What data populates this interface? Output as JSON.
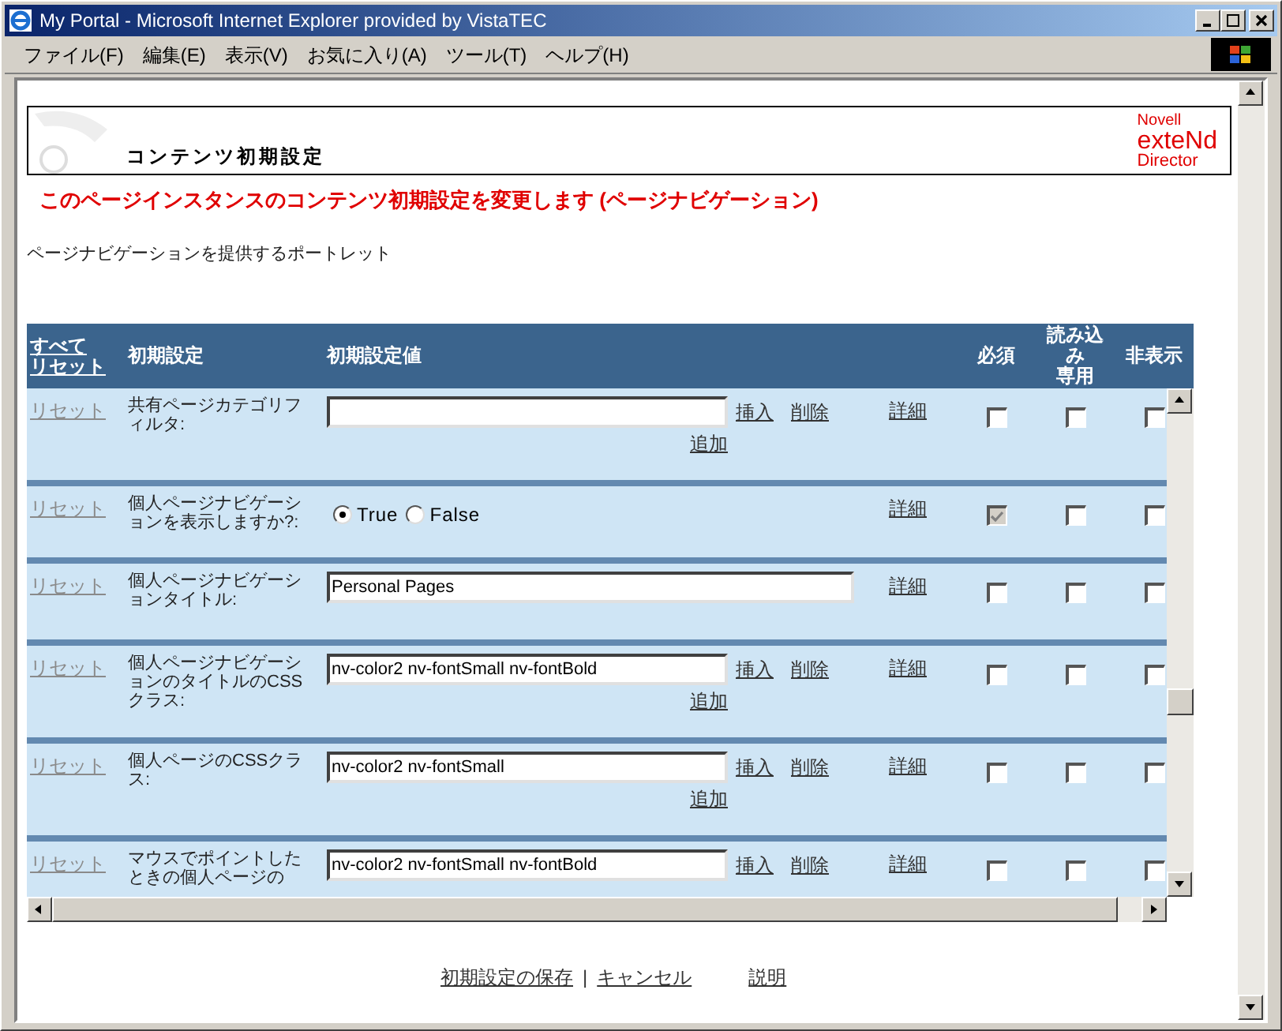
{
  "window": {
    "title": "My Portal - Microsoft Internet Explorer provided by VistaTEC"
  },
  "menu": [
    "ファイル(F)",
    "編集(E)",
    "表示(V)",
    "お気に入り(A)",
    "ツール(T)",
    "ヘルプ(H)"
  ],
  "portlet": {
    "title": "コンテンツ初期設定",
    "logo": {
      "brand": "Novell",
      "product": "exteNd",
      "edition": "Director"
    }
  },
  "heading": "このページインスタンスのコンテンツ初期設定を変更します (ページナビゲーション)",
  "description": "ページナビゲーションを提供するポートレット",
  "table": {
    "header": {
      "reset_all": [
        "すべて",
        "リセット"
      ],
      "setting": "初期設定",
      "value": "初期設定値",
      "required": "必須",
      "read_only": [
        "読み込み",
        "専用"
      ],
      "hidden": "非表示"
    },
    "rows": [
      {
        "kind": "list",
        "reset": "リセット",
        "label": "共有ページカテゴリフィルタ:",
        "insert": "挿入",
        "delete": "削除",
        "add": "追加",
        "detail": "詳細",
        "required": {
          "checked": false,
          "disabled": false
        },
        "read_only": false,
        "hidden": false
      },
      {
        "kind": "radio",
        "reset": "リセット",
        "label": "個人ページナビゲーションを表示しますか?:",
        "options": [
          {
            "label": "True",
            "selected": true
          },
          {
            "label": "False",
            "selected": false
          }
        ],
        "detail": "詳細",
        "required": {
          "checked": true,
          "disabled": true
        },
        "read_only": false,
        "hidden": false
      },
      {
        "kind": "text",
        "reset": "リセット",
        "label": "個人ページナビゲーションタイトル:",
        "value": "Personal Pages",
        "detail": "詳細",
        "required": {
          "checked": false,
          "disabled": false
        },
        "read_only": false,
        "hidden": false
      },
      {
        "kind": "list",
        "reset": "リセット",
        "label": "個人ページナビゲーションのタイトルのCSSクラス:",
        "value": "nv-color2 nv-fontSmall nv-fontBold",
        "insert": "挿入",
        "delete": "削除",
        "add": "追加",
        "detail": "詳細",
        "required": {
          "checked": false,
          "disabled": false
        },
        "read_only": false,
        "hidden": false
      },
      {
        "kind": "list",
        "reset": "リセット",
        "label": "個人ページのCSSクラス:",
        "value": "nv-color2 nv-fontSmall",
        "insert": "挿入",
        "delete": "削除",
        "add": "追加",
        "detail": "詳細",
        "required": {
          "checked": false,
          "disabled": false
        },
        "read_only": false,
        "hidden": false
      },
      {
        "kind": "list",
        "reset": "リセット",
        "label": "マウスでポイントしたときの個人ページの",
        "value": "nv-color2 nv-fontSmall nv-fontBold",
        "insert": "挿入",
        "delete": "削除",
        "detail": "詳細",
        "required": {
          "checked": false,
          "disabled": false
        },
        "read_only": false,
        "hidden": false
      }
    ]
  },
  "footer": {
    "save": "初期設定の保存",
    "separator": "|",
    "cancel": "キャンセル",
    "help": "説明"
  }
}
